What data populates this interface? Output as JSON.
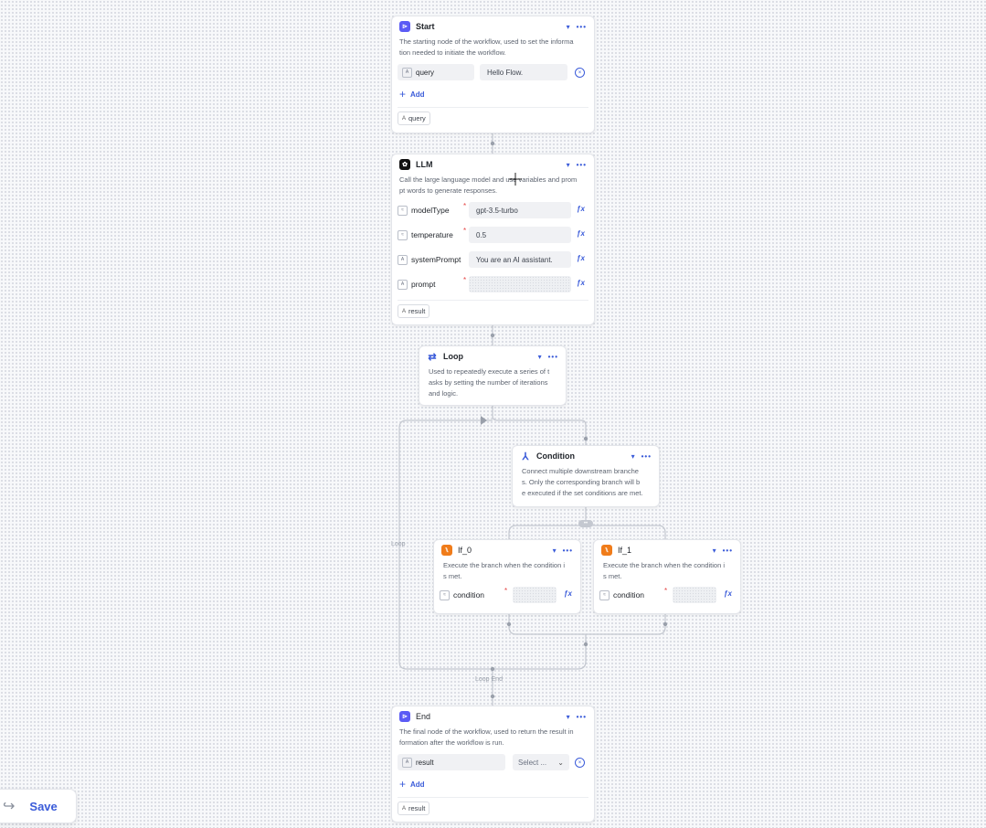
{
  "nodes": {
    "start": {
      "title": "Start",
      "icon": "start-icon",
      "color": "#5b5bf5",
      "desc_lines": [
        "The starting node of the workflow, used to set the informa",
        "tion needed to initiate the workflow."
      ],
      "input_name": "query",
      "input_value": "Hello Flow.",
      "add_label": "Add",
      "output": "query"
    },
    "llm": {
      "title": "LLM",
      "icon": "openai-icon",
      "color": "#111111",
      "desc_lines": [
        "Call the large language model and use variables and prom",
        "pt words to generate responses."
      ],
      "params": [
        {
          "name": "modelType",
          "value": "gpt-3.5-turbo"
        },
        {
          "name": "temperature",
          "value": "0.5"
        },
        {
          "name": "systemPrompt",
          "value": "You are an AI assistant."
        },
        {
          "name": "prompt",
          "value": ""
        }
      ],
      "output": "result"
    },
    "loop": {
      "title": "Loop",
      "icon": "loop-icon",
      "color": "#3a5bd9",
      "desc_lines": [
        "Used to repeatedly execute a series of t",
        "asks by setting the number of iterations",
        "and logic."
      ]
    },
    "condition": {
      "title": "Condition",
      "icon": "condition-icon",
      "color": "#3a5bd9",
      "desc_lines": [
        "Connect multiple downstream branche",
        "s. Only the corresponding branch will b",
        "e executed if the set conditions are met."
      ]
    },
    "if0": {
      "title": "If_0",
      "icon": "branch-icon",
      "color": "#f07c1a",
      "desc_lines": [
        "Execute the branch when the condition i",
        "s met."
      ],
      "param": "condition"
    },
    "if1": {
      "title": "If_1",
      "icon": "branch-icon",
      "color": "#f07c1a",
      "desc_lines": [
        "Execute the branch when the condition i",
        "s met."
      ],
      "param": "condition"
    },
    "end": {
      "title": "End",
      "icon": "end-icon",
      "color": "#5b5bf5",
      "desc_lines": [
        "The final node of the workflow, used to return the result in",
        "formation after the workflow is run."
      ],
      "input_name": "result",
      "select_placeholder": "Select ...",
      "add_label": "Add",
      "output": "result"
    }
  },
  "labels": {
    "loop_label": "Loop",
    "loop_end_label": "Loop End"
  },
  "toolbar": {
    "save_label": "Save"
  }
}
